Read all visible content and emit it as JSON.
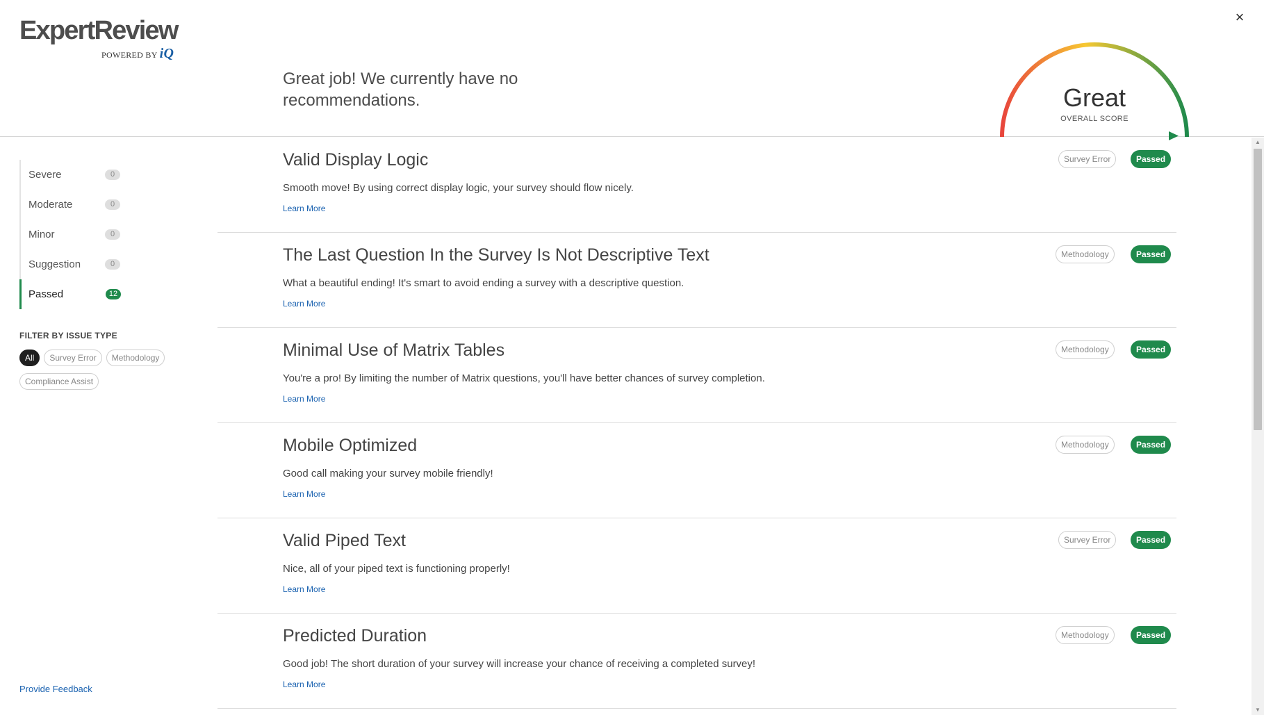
{
  "logo": {
    "brand": "ExpertReview",
    "powered_by": "POWERED BY",
    "iq": "iQ"
  },
  "header": {
    "close_glyph": "×",
    "summary": "Great job! We currently have no recommendations."
  },
  "score": {
    "label": "Great",
    "sub_label": "OVERALL SCORE",
    "level": 1.0,
    "colors": [
      "#e8453c",
      "#f7c832",
      "#1f8a4c"
    ]
  },
  "severity": [
    {
      "label": "Severe",
      "count": "0",
      "active": false
    },
    {
      "label": "Moderate",
      "count": "0",
      "active": false
    },
    {
      "label": "Minor",
      "count": "0",
      "active": false
    },
    {
      "label": "Suggestion",
      "count": "0",
      "active": false
    },
    {
      "label": "Passed",
      "count": "12",
      "active": true
    }
  ],
  "filter": {
    "title": "FILTER BY ISSUE TYPE",
    "chips": [
      {
        "label": "All",
        "active": true
      },
      {
        "label": "Survey Error",
        "active": false
      },
      {
        "label": "Methodology",
        "active": false
      },
      {
        "label": "Compliance Assist",
        "active": false
      }
    ]
  },
  "feedback_label": "Provide Feedback",
  "items": [
    {
      "title": "Valid Display Logic",
      "desc": "Smooth move! By using correct display logic, your survey should flow nicely.",
      "link": "Learn More",
      "type": "Survey Error",
      "status": "Passed"
    },
    {
      "title": "The Last Question In the Survey Is Not Descriptive Text",
      "desc": "What a beautiful ending! It's smart to avoid ending a survey with a descriptive question.",
      "link": "Learn More",
      "type": "Methodology",
      "status": "Passed"
    },
    {
      "title": "Minimal Use of Matrix Tables",
      "desc": "You're a pro! By limiting the number of Matrix questions, you'll have better chances of survey completion.",
      "link": "Learn More",
      "type": "Methodology",
      "status": "Passed"
    },
    {
      "title": "Mobile Optimized",
      "desc": "Good call making your survey mobile friendly!",
      "link": "Learn More",
      "type": "Methodology",
      "status": "Passed"
    },
    {
      "title": "Valid Piped Text",
      "desc": "Nice, all of your piped text is functioning properly!",
      "link": "Learn More",
      "type": "Survey Error",
      "status": "Passed"
    },
    {
      "title": "Predicted Duration",
      "desc": "Good job! The short duration of your survey will increase your chance of receiving a completed survey!",
      "link": "Learn More",
      "type": "Methodology",
      "status": "Passed"
    }
  ]
}
